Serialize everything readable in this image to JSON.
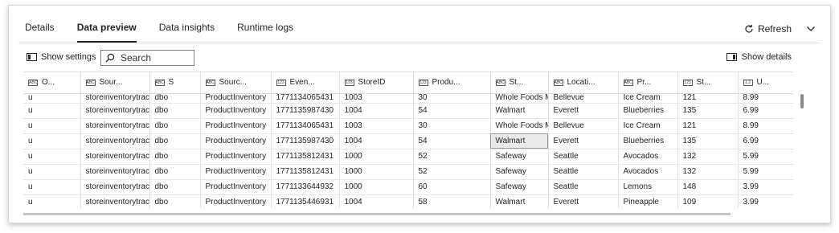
{
  "tabs": [
    {
      "label": "Details"
    },
    {
      "label": "Data preview"
    },
    {
      "label": "Data insights"
    },
    {
      "label": "Runtime logs"
    }
  ],
  "active_tab": "Data preview",
  "header": {
    "refresh_label": "Refresh"
  },
  "toolbar": {
    "show_settings_label": "Show settings",
    "search_placeholder": "Search",
    "show_details_label": "Show details"
  },
  "table": {
    "columns": [
      {
        "label": "O...",
        "type_label": "ABC"
      },
      {
        "label": "Sour...",
        "type_label": "ABC"
      },
      {
        "label": "S",
        "type_label": "ABC"
      },
      {
        "label": "Sourc...",
        "type_label": "ABC"
      },
      {
        "label": "Even...",
        "type_label": "123"
      },
      {
        "label": "StoreID",
        "type_label": "123"
      },
      {
        "label": "Produ...",
        "type_label": "123"
      },
      {
        "label": "St...",
        "type_label": "ABC"
      },
      {
        "label": "Locati...",
        "type_label": "ABC"
      },
      {
        "label": "Pr...",
        "type_label": "ABC"
      },
      {
        "label": "St...",
        "type_label": "123"
      },
      {
        "label": "U...",
        "type_label": "1.2"
      }
    ],
    "rows": [
      [
        "u",
        "storeinventorytracki",
        "dbo",
        "ProductInventory",
        "1771134065431",
        "1003",
        "30",
        "Whole Foods Ma",
        "Bellevue",
        "Ice Cream",
        "121",
        "8.99"
      ],
      [
        "u",
        "storeinventorytracki",
        "dbo",
        "ProductInventory",
        "1771135987430",
        "1004",
        "54",
        "Walmart",
        "Everett",
        "Blueberries",
        "135",
        "6.99"
      ],
      [
        "u",
        "storeinventorytracki",
        "dbo",
        "ProductInventory",
        "1771134065431",
        "1003",
        "30",
        "Whole Foods Ma",
        "Bellevue",
        "Ice Cream",
        "121",
        "8.99"
      ],
      [
        "u",
        "storeinventorytracki",
        "dbo",
        "ProductInventory",
        "1771135987430",
        "1004",
        "54",
        "Walmart",
        "Everett",
        "Blueberries",
        "135",
        "6.99"
      ],
      [
        "u",
        "storeinventorytracki",
        "dbo",
        "ProductInventory",
        "1771135812431",
        "1000",
        "52",
        "Safeway",
        "Seattle",
        "Avocados",
        "132",
        "5.99"
      ],
      [
        "u",
        "storeinventorytracki",
        "dbo",
        "ProductInventory",
        "1771135812431",
        "1000",
        "52",
        "Safeway",
        "Seattle",
        "Avocados",
        "132",
        "5.99"
      ],
      [
        "u",
        "storeinventorytracki",
        "dbo",
        "ProductInventory",
        "1771133644932",
        "1000",
        "60",
        "Safeway",
        "Seattle",
        "Lemons",
        "148",
        "3.99"
      ],
      [
        "u",
        "storeinventorytracki",
        "dbo",
        "ProductInventory",
        "1771135446931",
        "1004",
        "58",
        "Walmart",
        "Everett",
        "Pineapple",
        "109",
        "3.99"
      ]
    ]
  },
  "icons": {
    "refresh": "refresh-icon",
    "collapse": "chevron-down-icon",
    "settings": "show-settings-icon",
    "search": "search-icon",
    "details": "show-details-icon"
  }
}
